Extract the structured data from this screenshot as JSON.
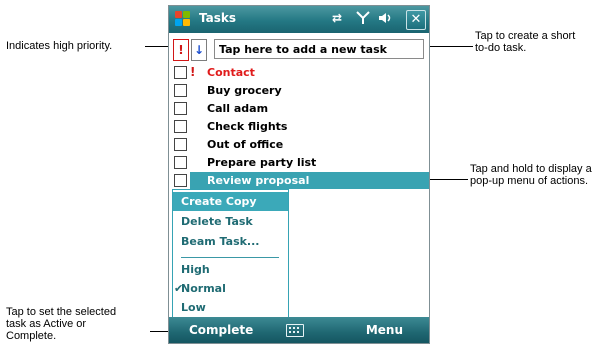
{
  "window": {
    "title": "Tasks",
    "status_icons": [
      "connectivity-icon",
      "signal-icon",
      "volume-icon"
    ],
    "close_label": "✕"
  },
  "toolbar": {
    "high_priority_label": "!",
    "low_priority_label": "↓",
    "new_task_placeholder": "Tap here to add a new task"
  },
  "tasks": [
    {
      "label": "Contact",
      "priority": "high",
      "selected": false
    },
    {
      "label": "Buy grocery",
      "priority": "normal",
      "selected": false
    },
    {
      "label": "Call adam",
      "priority": "normal",
      "selected": false
    },
    {
      "label": "Check flights",
      "priority": "normal",
      "selected": false
    },
    {
      "label": "Out of office",
      "priority": "normal",
      "selected": false
    },
    {
      "label": "Prepare party list",
      "priority": "normal",
      "selected": false
    },
    {
      "label": "Review proposal",
      "priority": "normal",
      "selected": true
    }
  ],
  "context_menu": {
    "items": [
      {
        "label": "Create Copy"
      },
      {
        "label": "Delete Task"
      },
      {
        "label": "Beam Task..."
      },
      {
        "label": "High"
      },
      {
        "label": "Normal",
        "checked": true
      },
      {
        "label": "Low"
      }
    ]
  },
  "softkeys": {
    "left": "Complete",
    "right": "Menu"
  },
  "callouts": {
    "high_priority": "Indicates high priority.",
    "new_task": [
      "Tap to create a short",
      "to-do task."
    ],
    "tap_hold": [
      "Tap and hold to display a",
      "pop-up menu of actions."
    ],
    "complete": [
      "Tap to set the selected",
      "task as Active or",
      "Complete."
    ]
  },
  "colors": {
    "title_bar": "#247884",
    "selection": "#39a3b2",
    "high_priority": "#e01b1b",
    "menu_text": "#1f6b73"
  }
}
